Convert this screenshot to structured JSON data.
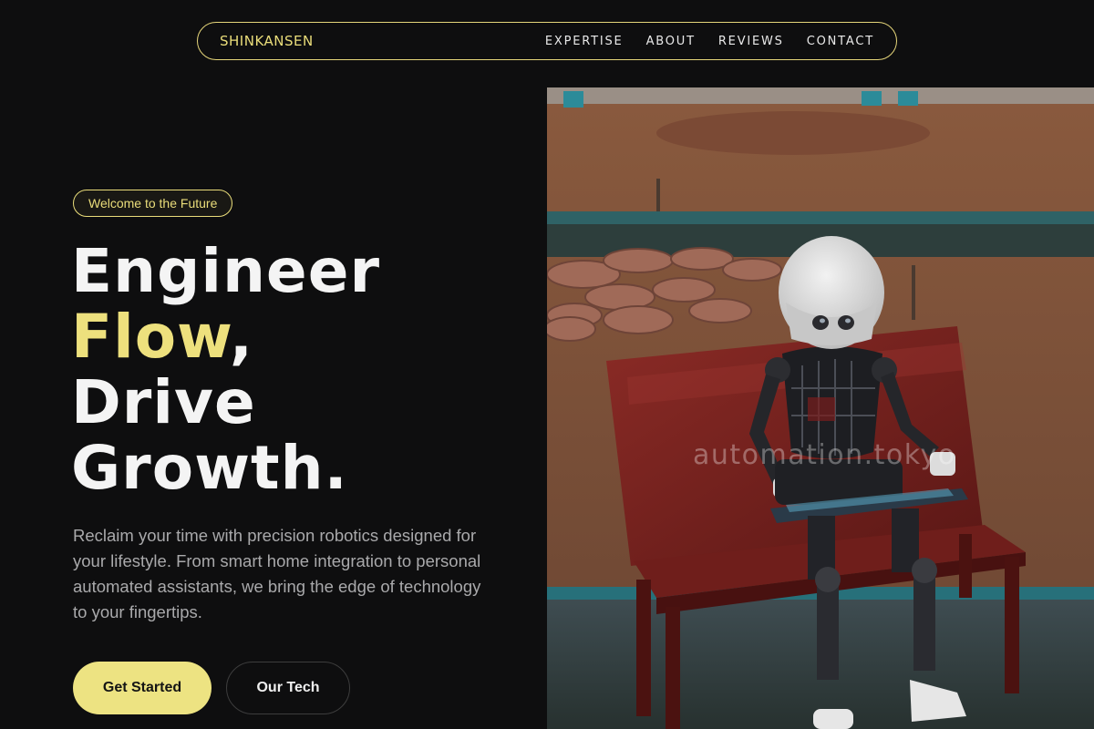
{
  "nav": {
    "brand": "SHINKANSEN",
    "links": [
      "EXPERTISE",
      "ABOUT",
      "REVIEWS",
      "CONTACT"
    ]
  },
  "hero": {
    "badge": "Welcome to the Future",
    "headline": {
      "line1": "Engineer",
      "accent": "Flow",
      "accent_suffix": ",",
      "line3": "Drive",
      "line4": "Growth."
    },
    "lead": "Reclaim your time with precision robotics designed for your lifestyle. From smart home integration to personal automated assistants, we bring the edge of technology to your fingertips.",
    "primary_cta": "Get Started",
    "secondary_cta": "Our Tech",
    "image_watermark": "automation.tokyo"
  },
  "colors": {
    "background": "#0e0e0f",
    "accent": "#ede07d",
    "text": "#f4f4f4",
    "muted": "#a9a9ab"
  }
}
